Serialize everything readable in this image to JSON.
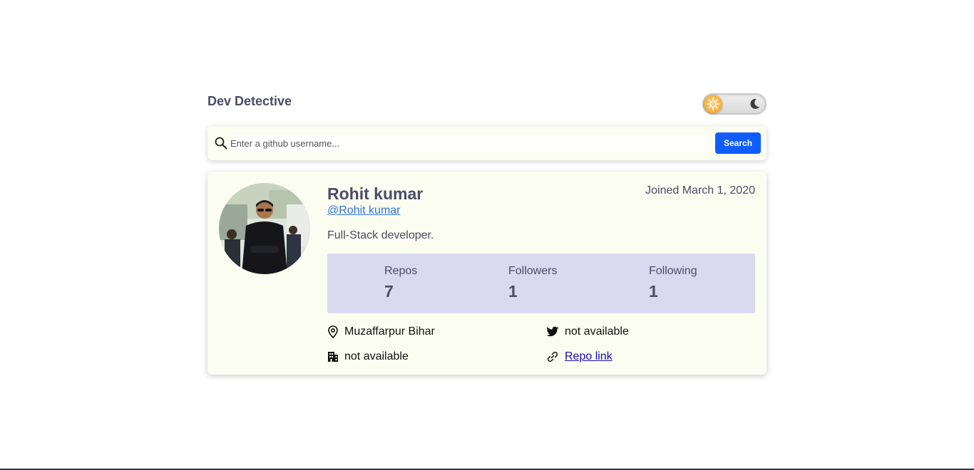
{
  "header": {
    "title": "Dev Detective"
  },
  "theme_toggle": {
    "mode": "light",
    "icons": [
      "sun-icon",
      "moon-icon"
    ]
  },
  "search": {
    "value": "",
    "placeholder": "Enter a github username...",
    "button_label": "Search"
  },
  "profile": {
    "name": "Rohit kumar",
    "handle": "@Rohit kumar",
    "joined": "Joined March 1, 2020",
    "bio": "Full-Stack developer.",
    "stats": [
      {
        "label": "Repos",
        "value": "7"
      },
      {
        "label": "Followers",
        "value": "1"
      },
      {
        "label": "Following",
        "value": "1"
      }
    ],
    "location": "Muzaffarpur Bihar",
    "twitter": "not available",
    "company": "not available",
    "website": "Repo link"
  },
  "colors": {
    "accent": "#0f5cff",
    "card_bg": "#fbfdf0",
    "stats_bg": "#d9d9f0",
    "text": "#4b4b6a",
    "link": "#2f6fe0"
  }
}
